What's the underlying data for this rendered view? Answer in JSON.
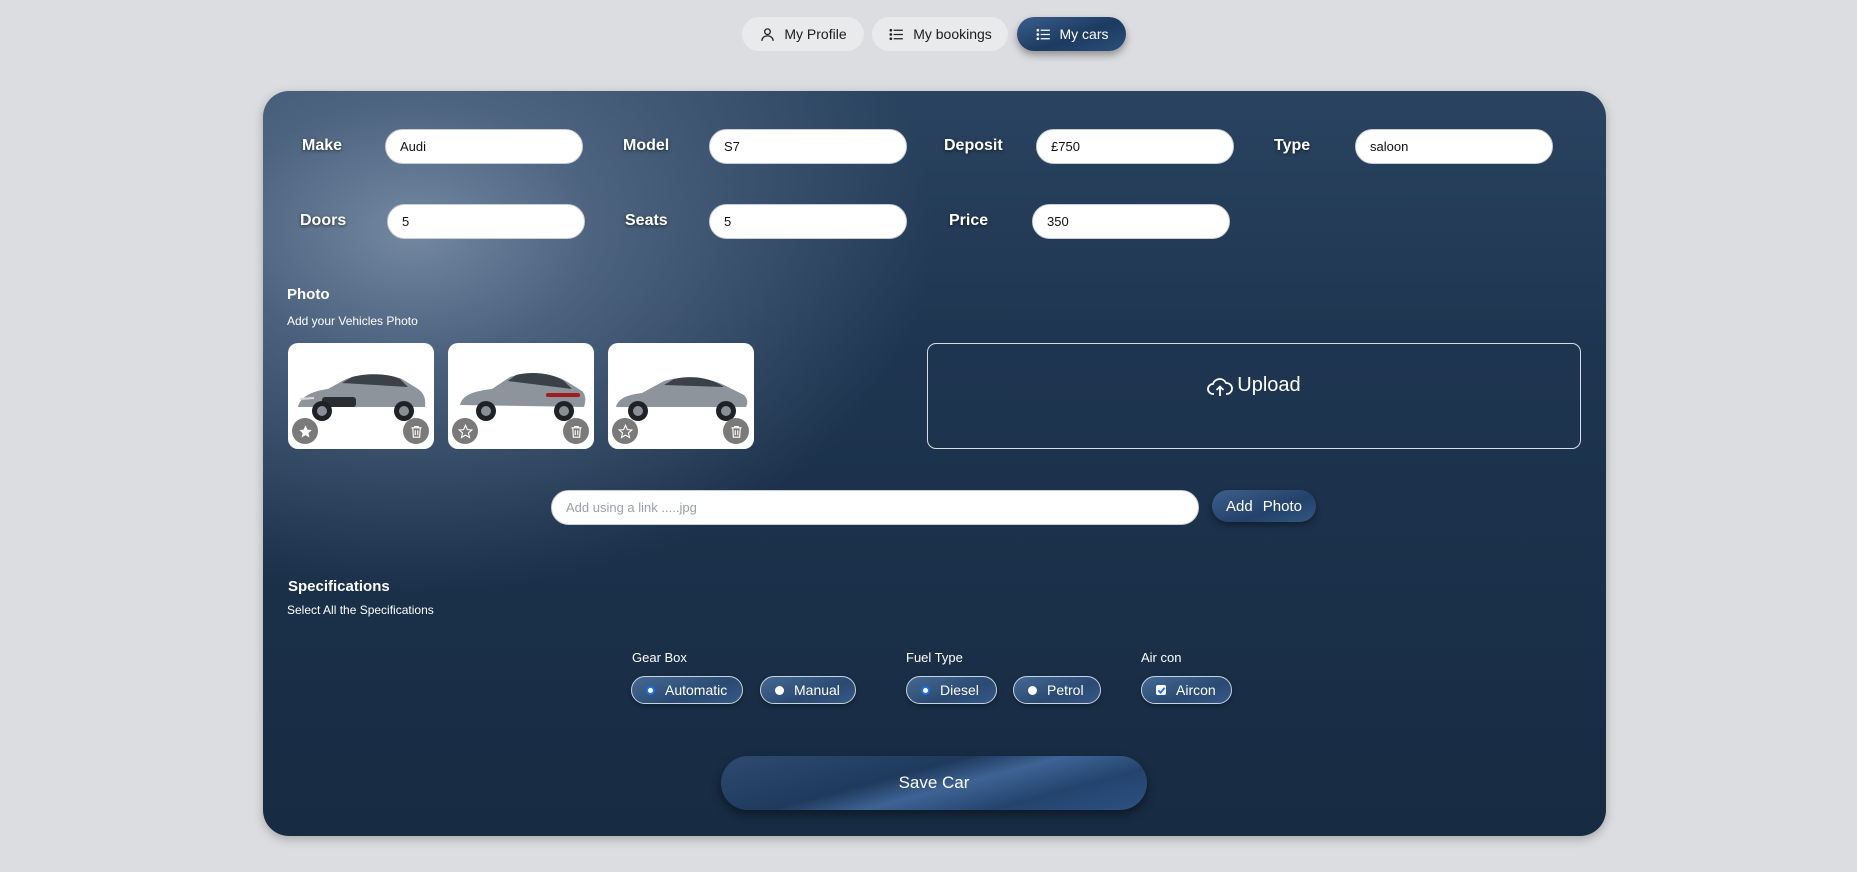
{
  "nav": {
    "items": [
      {
        "label": "My Profile",
        "icon": "user-icon"
      },
      {
        "label": "My bookings",
        "icon": "list-icon"
      },
      {
        "label": "My cars",
        "icon": "list-icon",
        "active": true
      }
    ]
  },
  "form": {
    "make": {
      "label": "Make",
      "value": "Audi"
    },
    "model": {
      "label": "Model",
      "value": "S7"
    },
    "deposit": {
      "label": "Deposit",
      "value": "£750"
    },
    "type": {
      "label": "Type",
      "value": "saloon"
    },
    "doors": {
      "label": "Doors",
      "value": "5"
    },
    "seats": {
      "label": "Seats",
      "value": "5"
    },
    "price": {
      "label": "Price",
      "value": "350"
    }
  },
  "photo": {
    "title": "Photo",
    "subtitle": "Add your Vehicles Photo",
    "thumbnails": [
      {
        "alt": "car-front-view",
        "starred": true
      },
      {
        "alt": "car-rear-view",
        "starred": false
      },
      {
        "alt": "car-side-view",
        "starred": false
      }
    ],
    "upload_label": "Upload",
    "link_placeholder": "Add using a link .....jpg",
    "add_label_1": "Add",
    "add_label_2": "Photo"
  },
  "specs": {
    "title": "Specifications",
    "subtitle": "Select All the Specifications",
    "gearbox": {
      "label": "Gear Box",
      "options": [
        "Automatic",
        "Manual"
      ],
      "selected": "Automatic"
    },
    "fuel": {
      "label": "Fuel Type",
      "options": [
        "Diesel",
        "Petrol"
      ],
      "selected": "Diesel"
    },
    "aircon": {
      "label": "Air con",
      "option": "Aircon",
      "checked": true
    }
  },
  "save_label": "Save Car",
  "colors": {
    "accent": "#1d3a60",
    "background": "#dcdde0",
    "card": "#1e3550"
  }
}
